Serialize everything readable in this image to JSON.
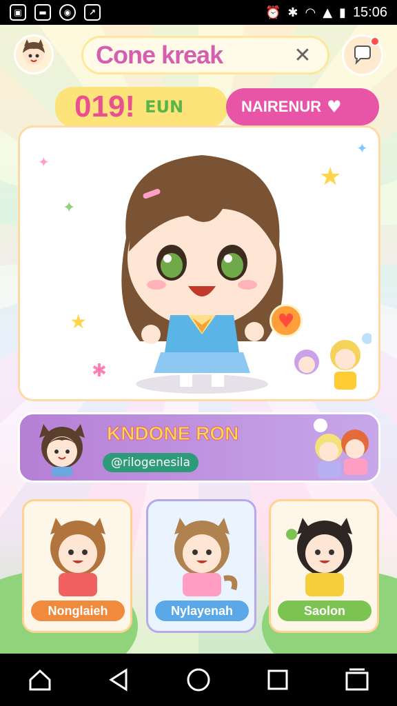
{
  "status_bar": {
    "time": "15:06",
    "icons": [
      "gallery-icon",
      "message-icon",
      "cat-icon",
      "share-icon",
      "alarm-icon",
      "bluetooth-icon",
      "wifi-icon",
      "signal-icon",
      "battery-icon"
    ]
  },
  "header": {
    "search_text": "Cone kreak",
    "clear_icon": "close-icon"
  },
  "tags": {
    "left_big": "019!",
    "left_small": "EUN",
    "right_label": "NAIRENUR"
  },
  "banner": {
    "title": "KNDONE RON",
    "handle": "@rilogenesila"
  },
  "characters": [
    {
      "label": "Nonglaieh",
      "color": "#f08a3d"
    },
    {
      "label": "Nylayenah",
      "color": "#5aa8e8"
    },
    {
      "label": "Saolon",
      "color": "#7cc452"
    }
  ],
  "colors": {
    "accent_pink": "#e855a6",
    "accent_yellow": "#fde47a",
    "accent_purple": "#b67fd6"
  }
}
